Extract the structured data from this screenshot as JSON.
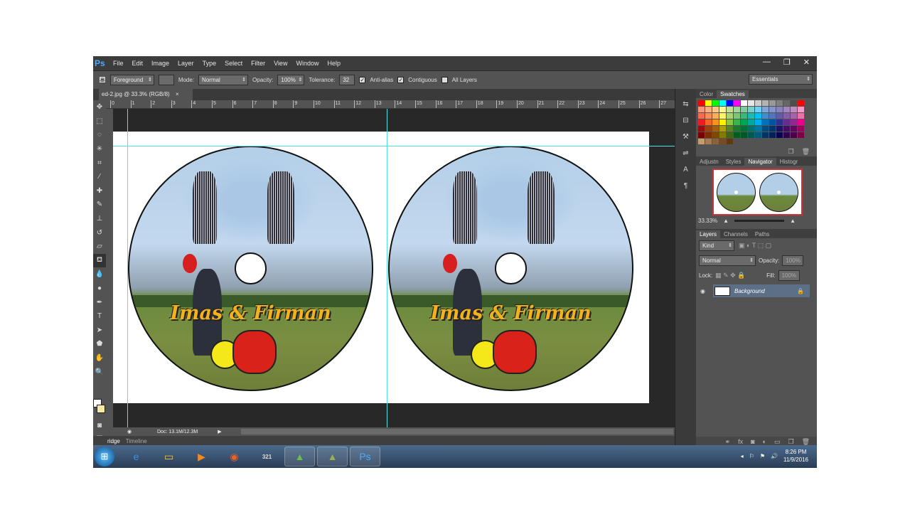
{
  "app": {
    "logo": "Ps"
  },
  "menu": [
    "File",
    "Edit",
    "Image",
    "Layer",
    "Type",
    "Select",
    "Filter",
    "View",
    "Window",
    "Help"
  ],
  "window_controls": [
    "—",
    "❐",
    "✕"
  ],
  "options": {
    "fill_source": "Foreground",
    "mode_label": "Mode:",
    "mode": "Normal",
    "opacity_label": "Opacity:",
    "opacity": "100%",
    "tolerance_label": "Tolerance:",
    "tolerance": "32",
    "anti_alias": "Anti-alias",
    "contiguous": "Contiguous",
    "all_layers": "All Layers",
    "workspace": "Essentials"
  },
  "document": {
    "tab_label": "ed-2.jpg @ 33.3% (RGB/8)",
    "close": "×",
    "disc_title": "Imas & Firman",
    "zoom": "33.33%",
    "doc_size": "Doc: 13.1M/12.3M"
  },
  "ruler_marks": [
    "0",
    "1",
    "2",
    "3",
    "4",
    "5",
    "6",
    "7",
    "8",
    "9",
    "10",
    "11",
    "12",
    "13",
    "14",
    "15",
    "16",
    "17",
    "18",
    "19",
    "20",
    "21",
    "22",
    "23",
    "24",
    "25",
    "26",
    "27"
  ],
  "bottom_tabs": [
    "ridge",
    "Timeline"
  ],
  "panels": {
    "color_tabs": [
      "Color",
      "Swatches"
    ],
    "nav_tabs": [
      "Adjustn",
      "Styles",
      "Navigator",
      "Histogr"
    ],
    "layer_tabs": [
      "Layers",
      "Channels",
      "Paths"
    ],
    "kind_label": "Kind",
    "blend_mode": "Normal",
    "opacity_label": "Opacity:",
    "opacity_value": "100%",
    "lock_label": "Lock:",
    "fill_label": "Fill:",
    "fill_value": "100%",
    "layer_name": "Background"
  },
  "swatches": [
    "#ff0000",
    "#ffff00",
    "#00ff00",
    "#00ffff",
    "#0000ff",
    "#ff00ff",
    "#ffffff",
    "#e6e6e6",
    "#cccccc",
    "#b3b3b3",
    "#999999",
    "#808080",
    "#666666",
    "#4d4d4d",
    "#ff0000",
    "#f7977a",
    "#f9ad81",
    "#fdc68a",
    "#fff79a",
    "#c4df9b",
    "#a2d39c",
    "#82ca9d",
    "#7bcdc8",
    "#6ecff6",
    "#7ea7d8",
    "#8493ca",
    "#8882be",
    "#a187be",
    "#bc8dbf",
    "#f49ac2",
    "#f26c4f",
    "#f68e55",
    "#fbaf5c",
    "#fff467",
    "#acd372",
    "#7cc576",
    "#3bb878",
    "#1abbb4",
    "#00bff3",
    "#438cca",
    "#5574b9",
    "#605ca8",
    "#855fa8",
    "#a763a8",
    "#f06ea9",
    "#ed1c24",
    "#f26522",
    "#f7941d",
    "#fff200",
    "#8dc73f",
    "#39b54a",
    "#00a651",
    "#00a99d",
    "#00aeef",
    "#0072bc",
    "#0054a6",
    "#2e3192",
    "#662d91",
    "#92278f",
    "#ec008c",
    "#9e0b0f",
    "#a0410d",
    "#a36209",
    "#aba000",
    "#598527",
    "#1a7b30",
    "#007236",
    "#00746b",
    "#0076a3",
    "#004b80",
    "#003471",
    "#1b1464",
    "#440e62",
    "#630460",
    "#9e005d",
    "#790000",
    "#7b2e00",
    "#7d4900",
    "#827b00",
    "#406618",
    "#005e20",
    "#005826",
    "#005952",
    "#005b7f",
    "#003663",
    "#002157",
    "#0d004c",
    "#32004b",
    "#4b0049",
    "#7b0046",
    "#c69c6d",
    "#a67c52",
    "#8c6239",
    "#754c24",
    "#603913"
  ],
  "taskbar": {
    "start": "⊞",
    "apps": [
      {
        "name": "ie-icon",
        "glyph": "e",
        "color": "#3a8ee6"
      },
      {
        "name": "explorer-icon",
        "glyph": "▭",
        "color": "#f3c34a"
      },
      {
        "name": "media-player-icon",
        "glyph": "▶",
        "color": "#f08a24"
      },
      {
        "name": "firefox-icon",
        "glyph": "◉",
        "color": "#e8602c"
      },
      {
        "name": "media-321-icon",
        "glyph": "321",
        "color": "#ddd"
      },
      {
        "name": "app-green-icon",
        "glyph": "▲",
        "color": "#6bc04b"
      },
      {
        "name": "app-dark-icon",
        "glyph": "▲",
        "color": "#9ab04a"
      },
      {
        "name": "photoshop-icon",
        "glyph": "Ps",
        "color": "#4fa8ff"
      }
    ],
    "tray": [
      "◂",
      "⚐",
      "⚑",
      "🔊"
    ],
    "time": "8:26 PM",
    "date": "11/9/2016"
  }
}
